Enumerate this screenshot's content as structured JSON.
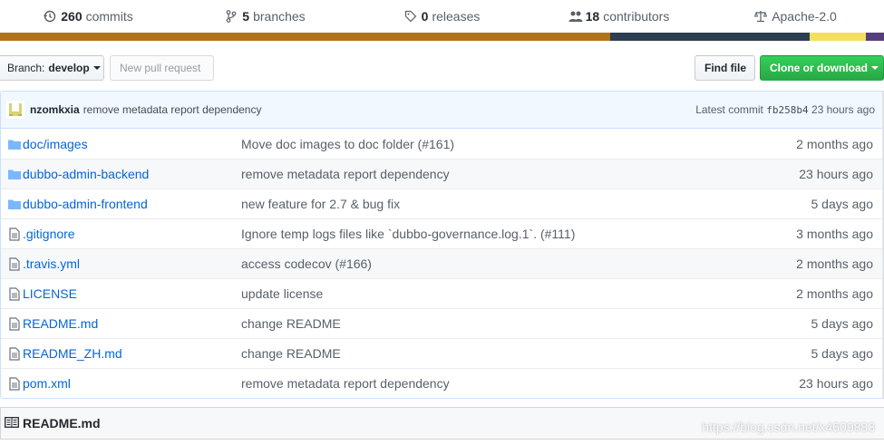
{
  "summary": [
    {
      "icon": "history-icon",
      "count": "260",
      "label": "commits"
    },
    {
      "icon": "branch-icon",
      "count": "5",
      "label": "branches"
    },
    {
      "icon": "tag-icon",
      "count": "0",
      "label": "releases"
    },
    {
      "icon": "people-icon",
      "count": "18",
      "label": "contributors"
    },
    {
      "icon": "law-icon",
      "count": "",
      "label": "Apache-2.0"
    }
  ],
  "language_bar": [
    {
      "color": "#b07219",
      "fraction": 0.69
    },
    {
      "color": "#2c3e50",
      "fraction": 0.226
    },
    {
      "color": "#f1e05a",
      "fraction": 0.063
    },
    {
      "color": "#563d7c",
      "fraction": 0.021
    }
  ],
  "toolbar": {
    "branch_prefix": "Branch:",
    "branch_name": "develop",
    "new_pr": "New pull request",
    "find_file": "Find file",
    "clone": "Clone or download"
  },
  "commit": {
    "author": "nzomkxia",
    "message": "remove metadata report dependency",
    "latest_label": "Latest commit",
    "sha": "fb258b4",
    "age": "23 hours ago"
  },
  "files": [
    {
      "type": "dir",
      "name": "doc/images",
      "message": "Move doc images to doc folder (#161)",
      "age": "2 months ago"
    },
    {
      "type": "dir",
      "name": "dubbo-admin-backend",
      "message": "remove metadata report dependency",
      "age": "23 hours ago"
    },
    {
      "type": "dir",
      "name": "dubbo-admin-frontend",
      "message": "new feature for 2.7 & bug fix",
      "age": "5 days ago"
    },
    {
      "type": "file",
      "name": ".gitignore",
      "message": "Ignore temp logs files like `dubbo-governance.log.1`. (#111)",
      "age": "3 months ago"
    },
    {
      "type": "file",
      "name": ".travis.yml",
      "message": "access codecov (#166)",
      "age": "2 months ago"
    },
    {
      "type": "file",
      "name": "LICENSE",
      "message": "update license",
      "age": "2 months ago"
    },
    {
      "type": "file",
      "name": "README.md",
      "message": "change README",
      "age": "5 days ago"
    },
    {
      "type": "file",
      "name": "README_ZH.md",
      "message": "change README",
      "age": "5 days ago"
    },
    {
      "type": "file",
      "name": "pom.xml",
      "message": "remove metadata report dependency",
      "age": "23 hours ago"
    }
  ],
  "readme": {
    "title": "README.md"
  },
  "watermark": "https://blog.csdn.net/x4609883",
  "colors": {
    "link": "#0366d6",
    "clone_green": "#28a745",
    "muted": "#586069"
  }
}
